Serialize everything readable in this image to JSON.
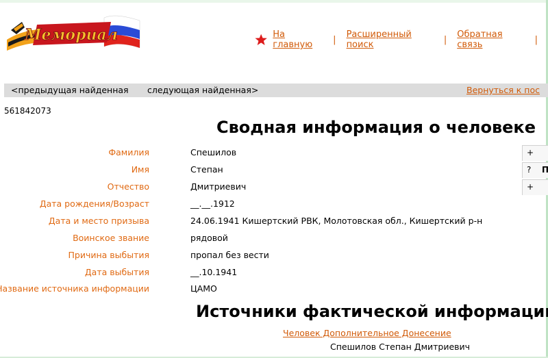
{
  "logo": {
    "text": "Мемориал"
  },
  "nav": {
    "home": "На главную",
    "advanced": "Расширенный поиск",
    "feedback": "Обратная связь",
    "separator": "|"
  },
  "navbar": {
    "prev": "<предыдущая найденная",
    "next": "следующая найденная>",
    "back": "Вернуться к пос"
  },
  "record_id": "561842073",
  "title": "Сводная информация о человеке",
  "fields": [
    {
      "label": "Фамилия",
      "value": "Спешилов"
    },
    {
      "label": "Имя",
      "value": "Степан"
    },
    {
      "label": "Отчество",
      "value": "Дмитриевич"
    },
    {
      "label": "Дата рождения/Возраст",
      "value": "__.__.1912"
    },
    {
      "label": "Дата и место призыва",
      "value": "24.06.1941 Кишертский РВК, Молотовская обл., Кишертский р-н"
    },
    {
      "label": "Воинское звание",
      "value": "рядовой"
    },
    {
      "label": "Причина выбытия",
      "value": "пропал без вести"
    },
    {
      "label": "Дата выбытия",
      "value": "__.10.1941"
    },
    {
      "label": "Название источника информации",
      "value": "ЦАМО"
    }
  ],
  "side_buttons": {
    "plus": "+",
    "question": "?",
    "question_suffix": "П"
  },
  "sources": {
    "title": "Источники фактической информации",
    "doc_link": "Человек Дополнительное Донесение",
    "person": "Спешилов Степан Дмитриевич"
  },
  "colors": {
    "accent": "#d15a08",
    "label": "#e06912",
    "bar": "#dcdcdc"
  }
}
